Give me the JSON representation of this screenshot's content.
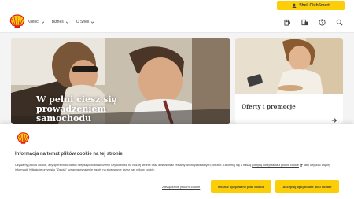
{
  "topbar": {
    "club_label": "Shell ClubSmart"
  },
  "nav": {
    "items": [
      {
        "label": "Klienci"
      },
      {
        "label": "Biznes"
      },
      {
        "label": "O Shell"
      }
    ],
    "icons": [
      "fuel-station-icon",
      "fuel-card-icon",
      "help-icon",
      "search-icon"
    ]
  },
  "hero": {
    "title": "W pełni ciesz się prowadzeniem samochodu"
  },
  "promo": {
    "title": "Oferty i promocje"
  },
  "cookie": {
    "title": "Informacja na temat plików cookie na tej stronie",
    "text_part1": "Używamy plików cookie, aby spersonalizować i ulepszyć doświadczenie użytkownika na naszej stronie oraz dostosować reklamy do indywidualnych potrzeb. Zapoznaj się z naszą ",
    "policy_link": "polityką korzystania z plików cookie",
    "text_part2": " aby uzyskać więcej informacji. Kliknięcie przycisku \"Zgoda\" oznacza wyrażenie zgody na stosowanie przez nas plików cookie.",
    "manage_label": "Zarządzanie plikami cookie",
    "reject_label": "Odrzuć opcjonalne pliki cookie",
    "accept_label": "Akceptuj opcjonalne pliki cookie"
  },
  "colors": {
    "brand_yellow": "#fbce07",
    "brand_red": "#dd1d21"
  }
}
